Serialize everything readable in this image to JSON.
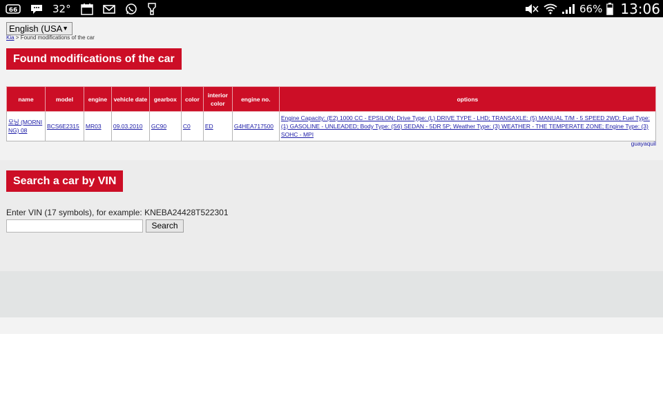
{
  "status_bar": {
    "left_icons": [
      "sixty-six-icon",
      "bbm-icon",
      "calendar-icon",
      "mail-icon",
      "whatsapp-icon",
      "flashlight-icon"
    ],
    "temperature": "32°",
    "right_icons": [
      "mute-icon",
      "wifi-icon",
      "signal-icon",
      "battery-icon"
    ],
    "battery_percent": "66%",
    "clock": "13:06"
  },
  "language_select": {
    "value": "English (USA"
  },
  "breadcrumb": {
    "root": "Kia",
    "separator": ">",
    "current": "Found modifications of the car"
  },
  "modifications": {
    "heading": "Found modifications of the car",
    "columns": [
      "name",
      "model",
      "engine",
      "vehicle date",
      "gearbox",
      "color",
      "interior color",
      "engine no.",
      "options"
    ],
    "rows": [
      {
        "name": "모닝 (MORNING) 08",
        "model": "BCS6E2315",
        "engine": "MR03",
        "vehicle_date": "09.03.2010",
        "gearbox": "GC90",
        "color": "C0",
        "interior_color": "ED",
        "engine_no": "G4HEA717500",
        "options": "Engine Capacity: (E2) 1000 CC - EPSILON; Drive Type: (L) DRIVE TYPE - LHD; TRANSAXLE: (5) MANUAL T/M - 5 SPEED 2WD; Fuel Type: (1) GASOLINE - UNLEADED; Body Type: (S6) SEDAN - 5DR 5P; Weather Type: (3) WEATHER - THE TEMPERATE ZONE; Engine Type: (3) SOHC - MPI"
      }
    ],
    "footer_link": "guayaquil"
  },
  "vin_search": {
    "heading": "Search a car by VIN",
    "prompt": "Enter VIN (17 symbols), for example: KNEBA24428T522301",
    "input_value": "",
    "button_label": "Search"
  }
}
